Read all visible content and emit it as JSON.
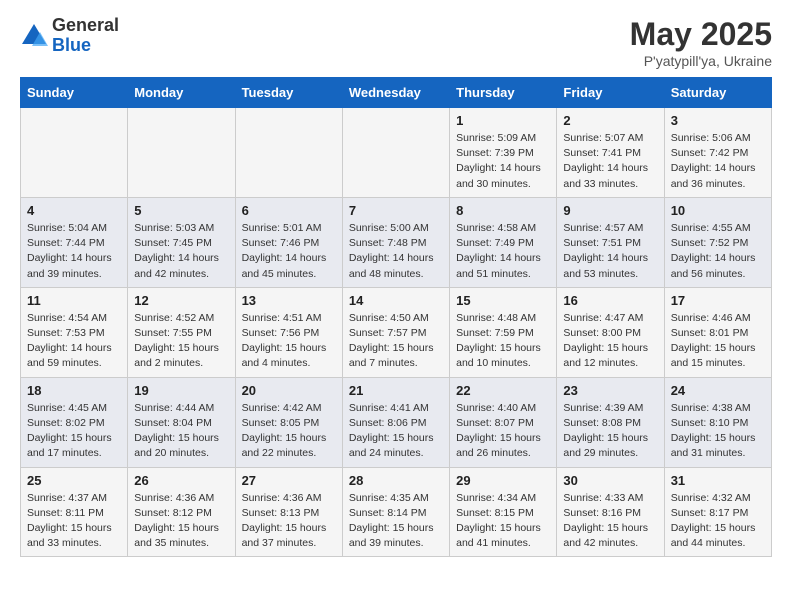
{
  "header": {
    "logo_general": "General",
    "logo_blue": "Blue",
    "title": "May 2025",
    "location": "P'yatypill'ya, Ukraine"
  },
  "days_of_week": [
    "Sunday",
    "Monday",
    "Tuesday",
    "Wednesday",
    "Thursday",
    "Friday",
    "Saturday"
  ],
  "weeks": [
    [
      {
        "day": "",
        "info": ""
      },
      {
        "day": "",
        "info": ""
      },
      {
        "day": "",
        "info": ""
      },
      {
        "day": "",
        "info": ""
      },
      {
        "day": "1",
        "info": "Sunrise: 5:09 AM\nSunset: 7:39 PM\nDaylight: 14 hours\nand 30 minutes."
      },
      {
        "day": "2",
        "info": "Sunrise: 5:07 AM\nSunset: 7:41 PM\nDaylight: 14 hours\nand 33 minutes."
      },
      {
        "day": "3",
        "info": "Sunrise: 5:06 AM\nSunset: 7:42 PM\nDaylight: 14 hours\nand 36 minutes."
      }
    ],
    [
      {
        "day": "4",
        "info": "Sunrise: 5:04 AM\nSunset: 7:44 PM\nDaylight: 14 hours\nand 39 minutes."
      },
      {
        "day": "5",
        "info": "Sunrise: 5:03 AM\nSunset: 7:45 PM\nDaylight: 14 hours\nand 42 minutes."
      },
      {
        "day": "6",
        "info": "Sunrise: 5:01 AM\nSunset: 7:46 PM\nDaylight: 14 hours\nand 45 minutes."
      },
      {
        "day": "7",
        "info": "Sunrise: 5:00 AM\nSunset: 7:48 PM\nDaylight: 14 hours\nand 48 minutes."
      },
      {
        "day": "8",
        "info": "Sunrise: 4:58 AM\nSunset: 7:49 PM\nDaylight: 14 hours\nand 51 minutes."
      },
      {
        "day": "9",
        "info": "Sunrise: 4:57 AM\nSunset: 7:51 PM\nDaylight: 14 hours\nand 53 minutes."
      },
      {
        "day": "10",
        "info": "Sunrise: 4:55 AM\nSunset: 7:52 PM\nDaylight: 14 hours\nand 56 minutes."
      }
    ],
    [
      {
        "day": "11",
        "info": "Sunrise: 4:54 AM\nSunset: 7:53 PM\nDaylight: 14 hours\nand 59 minutes."
      },
      {
        "day": "12",
        "info": "Sunrise: 4:52 AM\nSunset: 7:55 PM\nDaylight: 15 hours\nand 2 minutes."
      },
      {
        "day": "13",
        "info": "Sunrise: 4:51 AM\nSunset: 7:56 PM\nDaylight: 15 hours\nand 4 minutes."
      },
      {
        "day": "14",
        "info": "Sunrise: 4:50 AM\nSunset: 7:57 PM\nDaylight: 15 hours\nand 7 minutes."
      },
      {
        "day": "15",
        "info": "Sunrise: 4:48 AM\nSunset: 7:59 PM\nDaylight: 15 hours\nand 10 minutes."
      },
      {
        "day": "16",
        "info": "Sunrise: 4:47 AM\nSunset: 8:00 PM\nDaylight: 15 hours\nand 12 minutes."
      },
      {
        "day": "17",
        "info": "Sunrise: 4:46 AM\nSunset: 8:01 PM\nDaylight: 15 hours\nand 15 minutes."
      }
    ],
    [
      {
        "day": "18",
        "info": "Sunrise: 4:45 AM\nSunset: 8:02 PM\nDaylight: 15 hours\nand 17 minutes."
      },
      {
        "day": "19",
        "info": "Sunrise: 4:44 AM\nSunset: 8:04 PM\nDaylight: 15 hours\nand 20 minutes."
      },
      {
        "day": "20",
        "info": "Sunrise: 4:42 AM\nSunset: 8:05 PM\nDaylight: 15 hours\nand 22 minutes."
      },
      {
        "day": "21",
        "info": "Sunrise: 4:41 AM\nSunset: 8:06 PM\nDaylight: 15 hours\nand 24 minutes."
      },
      {
        "day": "22",
        "info": "Sunrise: 4:40 AM\nSunset: 8:07 PM\nDaylight: 15 hours\nand 26 minutes."
      },
      {
        "day": "23",
        "info": "Sunrise: 4:39 AM\nSunset: 8:08 PM\nDaylight: 15 hours\nand 29 minutes."
      },
      {
        "day": "24",
        "info": "Sunrise: 4:38 AM\nSunset: 8:10 PM\nDaylight: 15 hours\nand 31 minutes."
      }
    ],
    [
      {
        "day": "25",
        "info": "Sunrise: 4:37 AM\nSunset: 8:11 PM\nDaylight: 15 hours\nand 33 minutes."
      },
      {
        "day": "26",
        "info": "Sunrise: 4:36 AM\nSunset: 8:12 PM\nDaylight: 15 hours\nand 35 minutes."
      },
      {
        "day": "27",
        "info": "Sunrise: 4:36 AM\nSunset: 8:13 PM\nDaylight: 15 hours\nand 37 minutes."
      },
      {
        "day": "28",
        "info": "Sunrise: 4:35 AM\nSunset: 8:14 PM\nDaylight: 15 hours\nand 39 minutes."
      },
      {
        "day": "29",
        "info": "Sunrise: 4:34 AM\nSunset: 8:15 PM\nDaylight: 15 hours\nand 41 minutes."
      },
      {
        "day": "30",
        "info": "Sunrise: 4:33 AM\nSunset: 8:16 PM\nDaylight: 15 hours\nand 42 minutes."
      },
      {
        "day": "31",
        "info": "Sunrise: 4:32 AM\nSunset: 8:17 PM\nDaylight: 15 hours\nand 44 minutes."
      }
    ]
  ]
}
